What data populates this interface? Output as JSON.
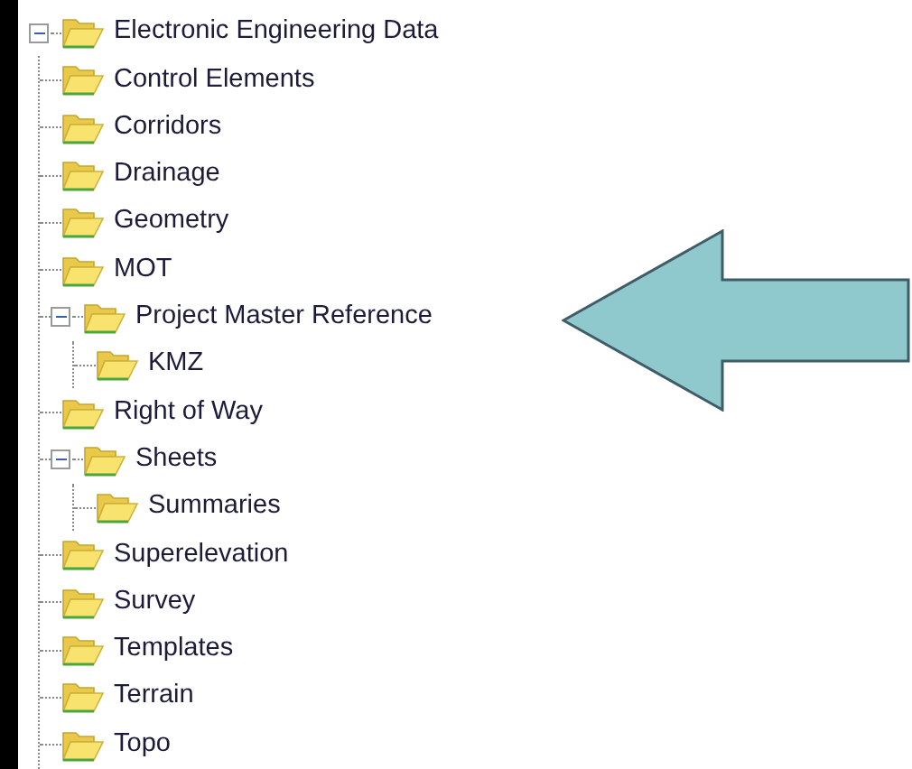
{
  "tree": [
    {
      "label": "Electronic Engineering Data",
      "expanded": true,
      "children": [
        {
          "label": "Control Elements"
        },
        {
          "label": "Corridors"
        },
        {
          "label": "Drainage"
        },
        {
          "label": "Geometry"
        },
        {
          "label": "MOT"
        },
        {
          "label": "Project Master Reference",
          "expanded": true,
          "children": [
            {
              "label": "KMZ"
            }
          ]
        },
        {
          "label": "Right of Way"
        },
        {
          "label": "Sheets",
          "expanded": true,
          "children": [
            {
              "label": "Summaries"
            }
          ]
        },
        {
          "label": "Superelevation"
        },
        {
          "label": "Survey"
        },
        {
          "label": "Templates"
        },
        {
          "label": "Terrain"
        },
        {
          "label": "Topo"
        }
      ]
    }
  ]
}
